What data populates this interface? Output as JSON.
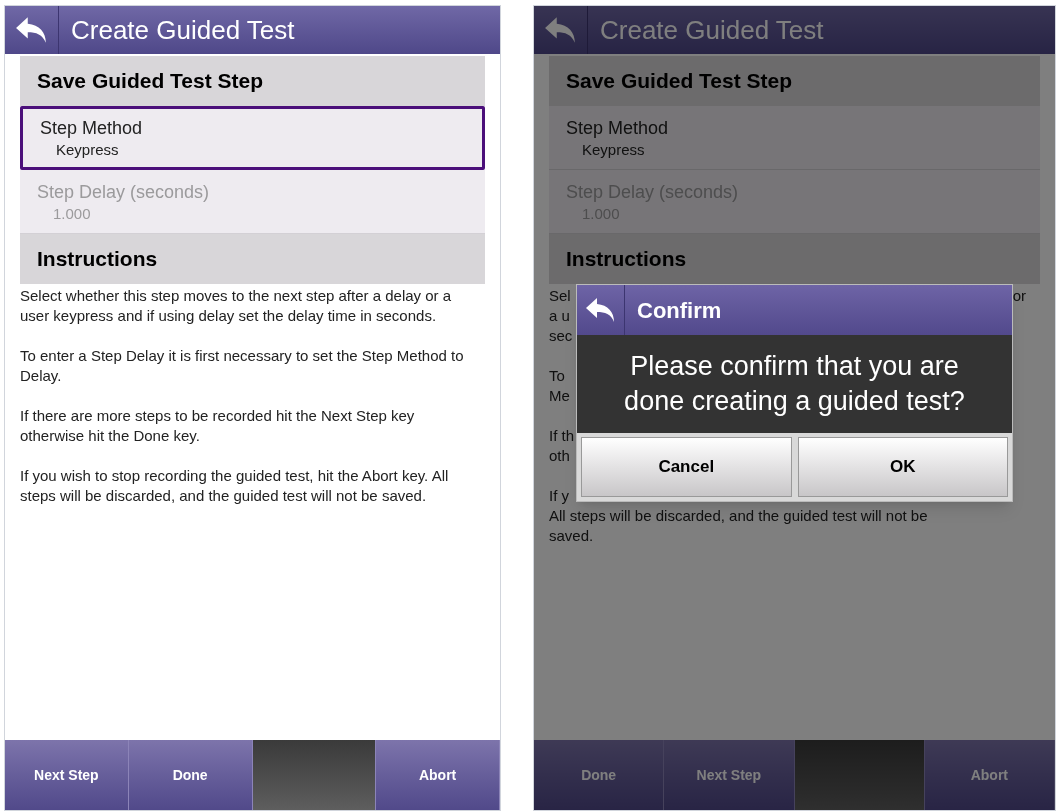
{
  "screens": [
    {
      "title": "Create Guided Test",
      "dimmed": false,
      "section_heading": "Save Guided Test Step",
      "fields": [
        {
          "label": "Step Method",
          "value": "Keypress",
          "selected": true,
          "disabled": false
        },
        {
          "label": "Step Delay (seconds)",
          "value": "1.000",
          "selected": false,
          "disabled": true
        }
      ],
      "instructions_heading": "Instructions",
      "paragraphs": [
        [
          {
            "left": "Select whether this step moves to the next step after a delay or a user keypress and if using delay set the delay time in seconds."
          }
        ],
        [
          {
            "left": "To enter a Step Delay it is first necessary to set the Step Method to Delay."
          }
        ],
        [
          {
            "left": "If there are more steps to be recorded hit the Next Step key otherwise hit the Done key."
          }
        ],
        [
          {
            "left": "If you wish to stop recording the guided test, hit the Abort key. All steps will be discarded, and the guided test will not be saved."
          }
        ]
      ],
      "footer_keys": [
        {
          "kind": "key",
          "label": "Next Step"
        },
        {
          "kind": "key",
          "label": "Done"
        },
        {
          "kind": "blank"
        },
        {
          "kind": "key",
          "label": "Abort"
        }
      ]
    },
    {
      "title": "Create Guided Test",
      "dimmed": true,
      "section_heading": "Save Guided Test Step",
      "fields": [
        {
          "label": "Step Method",
          "value": "Keypress",
          "selected": false,
          "disabled": false
        },
        {
          "label": "Step Delay (seconds)",
          "value": "1.000",
          "selected": false,
          "disabled": true
        }
      ],
      "instructions_heading": "Instructions",
      "paragraphs": [
        [
          {
            "left": "Sel",
            "right": "or"
          },
          {
            "left": "a u"
          },
          {
            "left": "sec"
          }
        ],
        [
          {
            "left": "To"
          },
          {
            "left": "Me"
          }
        ],
        [
          {
            "left": "If th"
          },
          {
            "left": "oth"
          }
        ],
        [
          {
            "left": "If y"
          },
          {
            "left": "All steps will be discarded, and the guided test will not be"
          },
          {
            "left": "saved."
          }
        ]
      ],
      "footer_keys": [
        {
          "kind": "key",
          "label": "Done"
        },
        {
          "kind": "key",
          "label": "Next Step"
        },
        {
          "kind": "blank"
        },
        {
          "kind": "key",
          "label": "Abort"
        }
      ],
      "dialog": {
        "title": "Confirm",
        "message": "Please confirm that you are done creating a guided test?",
        "buttons": [
          "Cancel",
          "OK"
        ]
      }
    }
  ]
}
